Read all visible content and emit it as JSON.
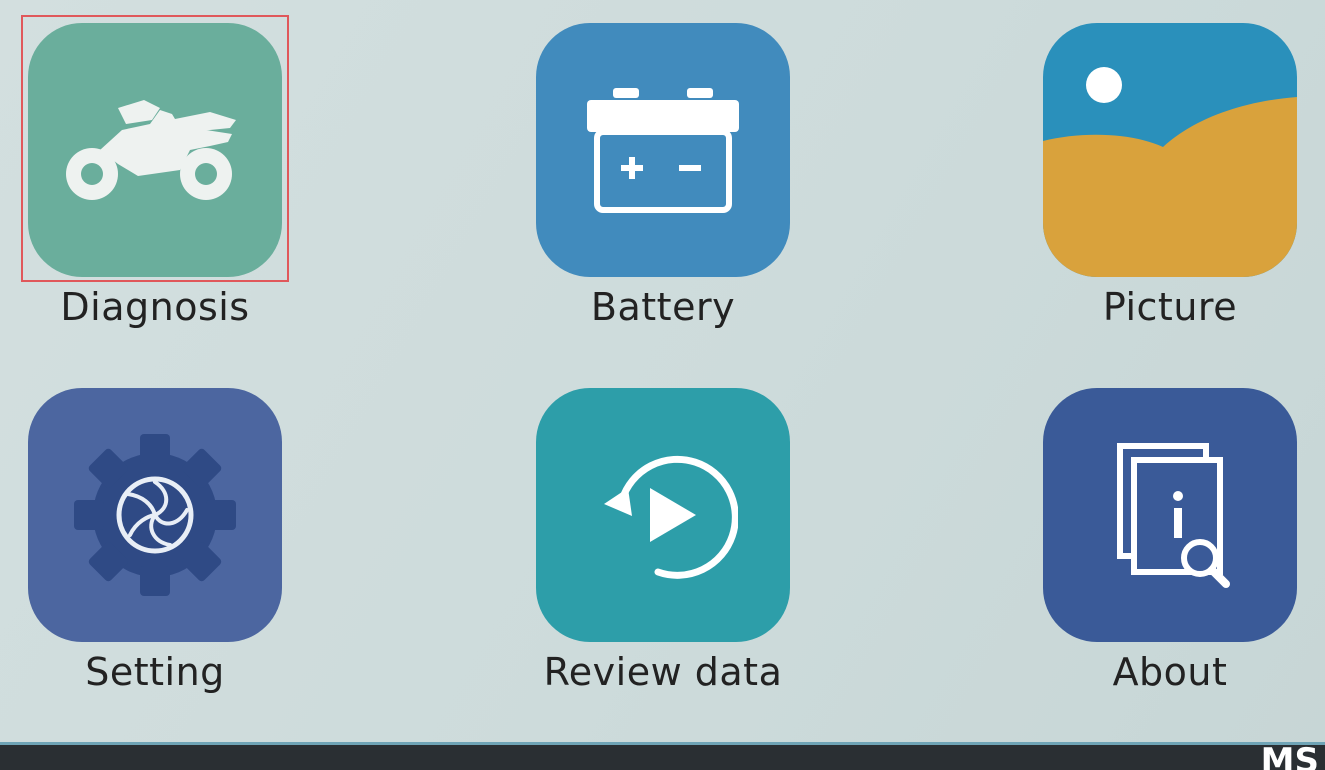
{
  "menu": {
    "items": [
      {
        "label": "Diagnosis",
        "icon": "motorcycle-icon",
        "color": "#6aae9c",
        "selected": true
      },
      {
        "label": "Battery",
        "icon": "battery-icon",
        "color": "#418bbd",
        "selected": false
      },
      {
        "label": "Picture",
        "icon": "picture-icon",
        "color": "#2a90bb",
        "selected": false
      },
      {
        "label": "Setting",
        "icon": "gear-icon",
        "color": "#4c66a0",
        "selected": false
      },
      {
        "label": "Review data",
        "icon": "replay-icon",
        "color": "#2d9ea9",
        "selected": false
      },
      {
        "label": "About",
        "icon": "about-info-icon",
        "color": "#3a5a98",
        "selected": false
      }
    ]
  },
  "colors": {
    "selection": "#e0585b",
    "background": "#cfdcdc",
    "bottom_bar": "#2a2f33"
  },
  "bottom_bar": {
    "brand_text": "MS"
  }
}
